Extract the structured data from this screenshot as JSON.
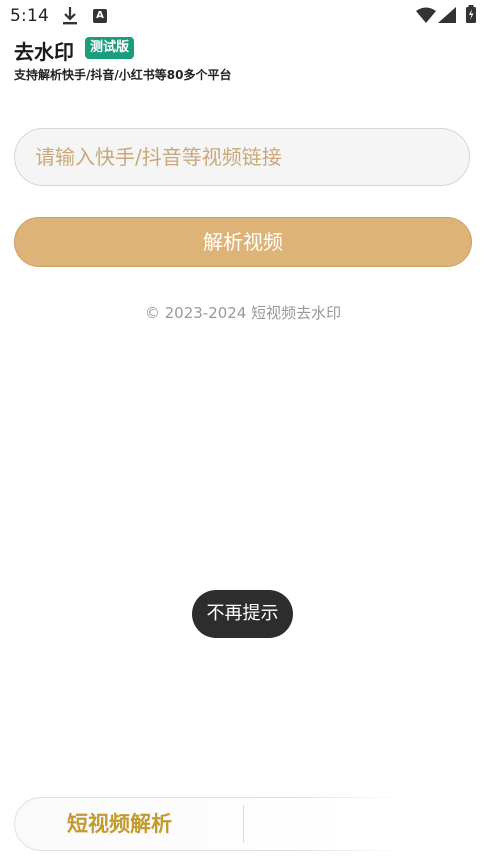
{
  "status_bar": {
    "time": "5:14",
    "download_icon": "download-icon",
    "notification_icon_letter": "A",
    "wifi_icon": "wifi-icon",
    "signal_icon": "signal-icon",
    "battery_icon": "battery-icon"
  },
  "header": {
    "title": "去水印",
    "badge": "测试版",
    "badge_color": "#1a9c7d",
    "subtitle": "支持解析快手/抖音/小红书等80多个平台"
  },
  "main": {
    "input_value": "",
    "input_placeholder": "请输入快手/抖音等视频链接",
    "parse_button_label": "解析视频",
    "button_color": "#ddb377",
    "copyright": "© 2023-2024 短视频去水印"
  },
  "toast": {
    "text": "不再提示"
  },
  "bottom_bar": {
    "tab_label": "短视频解析",
    "accent_color": "#c39a2f"
  }
}
